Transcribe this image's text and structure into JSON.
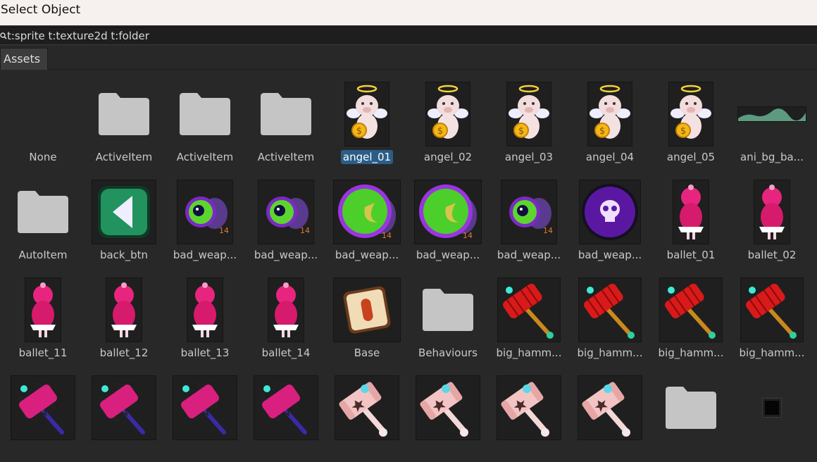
{
  "window": {
    "title": "Select Object"
  },
  "search": {
    "query": "t:sprite t:texture2d t:folder"
  },
  "tabs": [
    {
      "label": "Assets"
    }
  ],
  "colors": {
    "selection": "#2c5d87",
    "folder": "#c5c5c5",
    "background": "#282828"
  },
  "rows": [
    [
      {
        "label": "None",
        "icon": "none"
      },
      {
        "label": "ActiveItem",
        "icon": "folder-icon"
      },
      {
        "label": "ActiveItem",
        "icon": "folder-icon"
      },
      {
        "label": "ActiveItem",
        "icon": "folder-icon"
      },
      {
        "label": "angel_01",
        "icon": "angel-sprite",
        "selected": true
      },
      {
        "label": "angel_02",
        "icon": "angel-sprite"
      },
      {
        "label": "angel_03",
        "icon": "angel-sprite"
      },
      {
        "label": "angel_04",
        "icon": "angel-sprite"
      },
      {
        "label": "angel_05",
        "icon": "angel-sprite"
      },
      {
        "label": "ani_bg_ba...",
        "icon": "wave-sprite"
      }
    ],
    [
      {
        "label": "AutoItem",
        "icon": "folder-icon"
      },
      {
        "label": "back_btn",
        "icon": "back-button-sprite"
      },
      {
        "label": "bad_weap...",
        "icon": "eye-bomb-small-sprite"
      },
      {
        "label": "bad_weap...",
        "icon": "eye-bomb-small-sprite"
      },
      {
        "label": "bad_weap...",
        "icon": "green-bomb-large-sprite"
      },
      {
        "label": "bad_weap...",
        "icon": "green-bomb-large-sprite"
      },
      {
        "label": "bad_weap...",
        "icon": "eye-bomb-small-sprite"
      },
      {
        "label": "bad_weap...",
        "icon": "skull-orb-sprite"
      },
      {
        "label": "ballet_01",
        "icon": "ballet-pig-sprite"
      },
      {
        "label": "ballet_02",
        "icon": "ballet-pig-sprite"
      }
    ],
    [
      {
        "label": "ballet_11",
        "icon": "ballet-pig-sprite"
      },
      {
        "label": "ballet_12",
        "icon": "ballet-pig-sprite"
      },
      {
        "label": "ballet_13",
        "icon": "ballet-pig-sprite"
      },
      {
        "label": "ballet_14",
        "icon": "ballet-pig-sprite"
      },
      {
        "label": "Base",
        "icon": "base-card-sprite"
      },
      {
        "label": "Behaviours",
        "icon": "folder-icon"
      },
      {
        "label": "big_hamm...",
        "icon": "red-hammer-sprite"
      },
      {
        "label": "big_hamm...",
        "icon": "red-hammer-sprite"
      },
      {
        "label": "big_hamm...",
        "icon": "red-hammer-sprite"
      },
      {
        "label": "big_hamm...",
        "icon": "red-hammer-sprite"
      }
    ],
    [
      {
        "label": "",
        "icon": "pink-spiked-hammer-sprite"
      },
      {
        "label": "",
        "icon": "pink-spiked-hammer-sprite"
      },
      {
        "label": "",
        "icon": "pink-spiked-hammer-sprite"
      },
      {
        "label": "",
        "icon": "pink-spiked-hammer-sprite"
      },
      {
        "label": "",
        "icon": "bone-hammer-sprite"
      },
      {
        "label": "",
        "icon": "bone-hammer-sprite"
      },
      {
        "label": "",
        "icon": "bone-hammer-sprite"
      },
      {
        "label": "",
        "icon": "bone-hammer-sprite"
      },
      {
        "label": "",
        "icon": "folder-icon"
      },
      {
        "label": "",
        "icon": "black-square-sprite"
      }
    ]
  ]
}
